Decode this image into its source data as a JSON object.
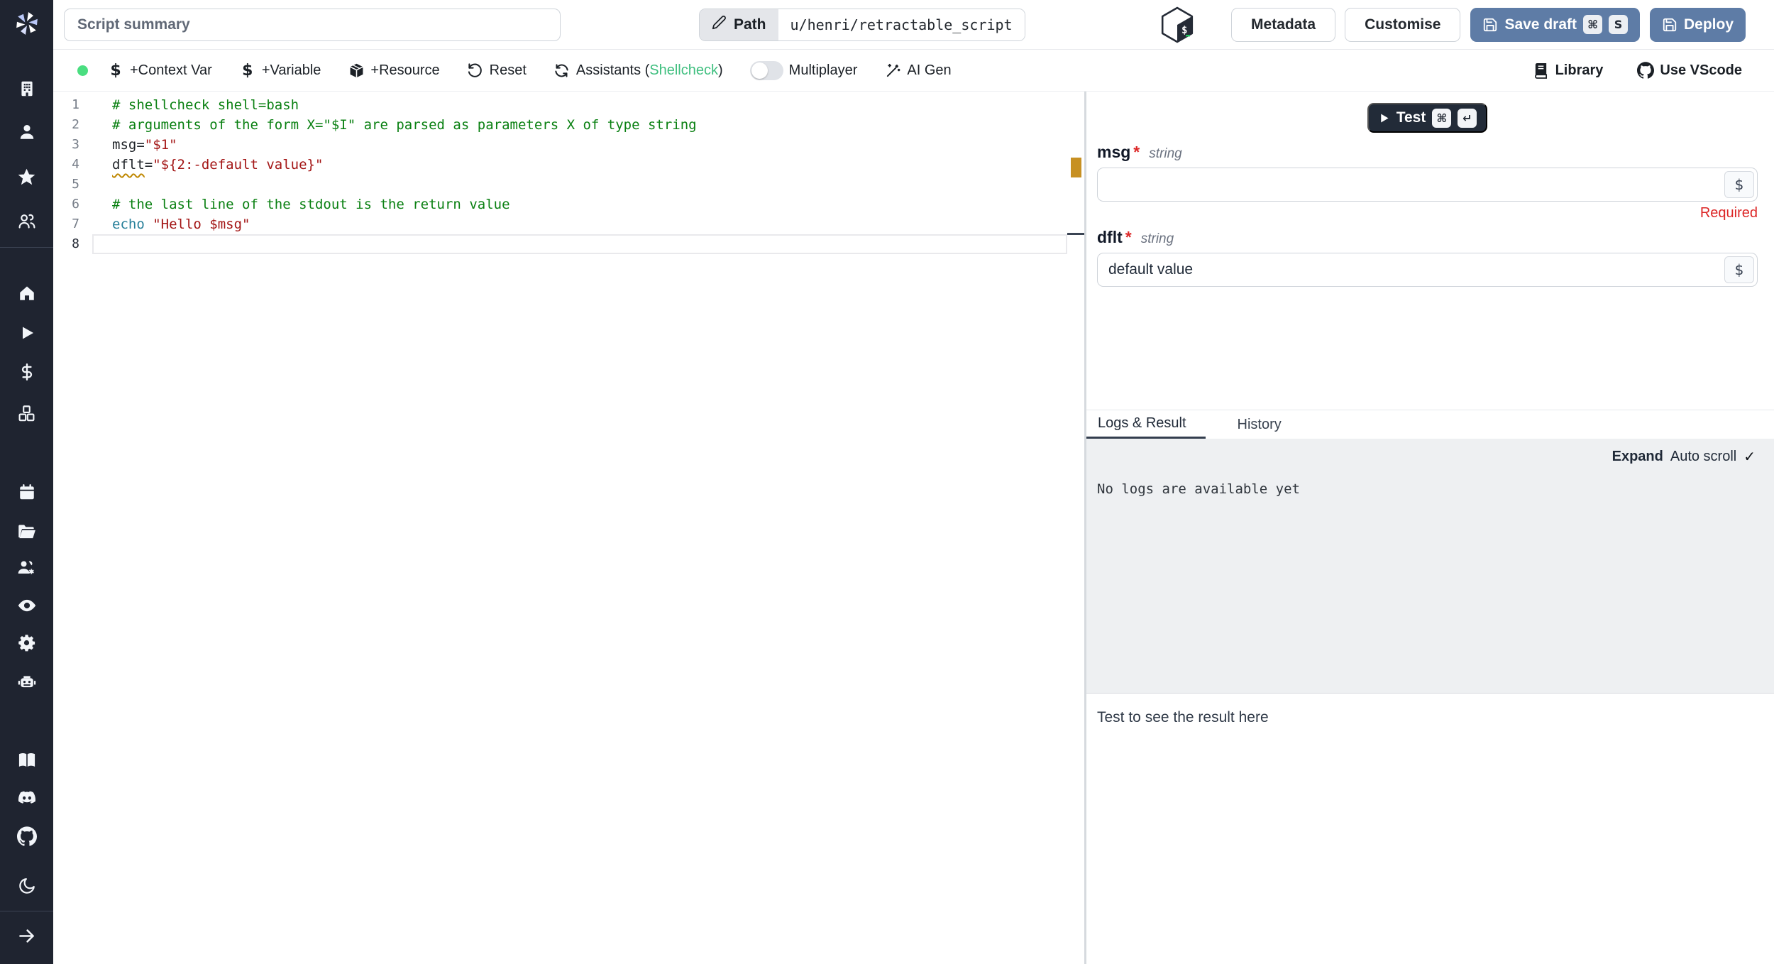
{
  "colors": {
    "accent_blue": "#5e7ca6",
    "sidebar_bg": "#1f2430",
    "status_green": "#4ade80",
    "lint_green": "#3fbf7f",
    "error_red": "#dc2626",
    "warning_amber": "#bf8803"
  },
  "topbar": {
    "summary_placeholder": "Script summary",
    "path_button": "Path",
    "path_value": "u/henri/retractable_script",
    "language_icon": "bash-icon",
    "metadata": "Metadata",
    "customise": "Customise",
    "save_draft": "Save draft",
    "save_draft_kbd": {
      "mod": "⌘",
      "key": "S"
    },
    "deploy": "Deploy"
  },
  "toolbar": {
    "items": [
      {
        "icon": "dollar-icon",
        "label": "+Context Var"
      },
      {
        "icon": "dollar-icon",
        "label": "+Variable"
      },
      {
        "icon": "package-icon",
        "label": "+Resource"
      },
      {
        "icon": "reset-icon",
        "label": "Reset"
      },
      {
        "icon": "refresh-icon",
        "label": "Assistants (",
        "highlight": "Shellcheck",
        "suffix": ")"
      },
      {
        "icon": "toggle",
        "label": "Multiplayer"
      },
      {
        "icon": "wand-icon",
        "label": "AI Gen"
      }
    ],
    "right_items": [
      {
        "icon": "book-icon",
        "label": "Library"
      },
      {
        "icon": "github-icon",
        "label": "Use VScode"
      }
    ]
  },
  "editor": {
    "lines": [
      {
        "n": "1",
        "segments": [
          {
            "cls": "comment",
            "text": "# shellcheck shell=bash"
          }
        ]
      },
      {
        "n": "2",
        "segments": [
          {
            "cls": "comment",
            "text": "# arguments of the form X=\"$I\" are parsed as parameters X of type string"
          }
        ]
      },
      {
        "n": "3",
        "segments": [
          {
            "cls": "plain",
            "text": "msg="
          },
          {
            "cls": "string",
            "text": "\"$1\""
          }
        ]
      },
      {
        "n": "4",
        "segments": [
          {
            "cls": "plain",
            "text": "dflt",
            "squiggle": true
          },
          {
            "cls": "plain",
            "text": "="
          },
          {
            "cls": "string",
            "text": "\"${2:-default value}\""
          }
        ]
      },
      {
        "n": "5",
        "segments": []
      },
      {
        "n": "6",
        "segments": [
          {
            "cls": "comment",
            "text": "# the last line of the stdout is the return value"
          }
        ]
      },
      {
        "n": "7",
        "segments": [
          {
            "cls": "keyword",
            "text": "echo"
          },
          {
            "cls": "plain",
            "text": " "
          },
          {
            "cls": "string",
            "text": "\"Hello $msg\""
          }
        ]
      },
      {
        "n": "8",
        "segments": [],
        "active": true
      }
    ]
  },
  "run_panel": {
    "test": "Test",
    "test_kbd": {
      "mod": "⌘",
      "key": "↵"
    },
    "fields": [
      {
        "name": "msg",
        "star": "*",
        "type": "string",
        "value": "",
        "error": "Required",
        "dollar": "$"
      },
      {
        "name": "dflt",
        "star": "*",
        "type": "string",
        "value": "default value",
        "dollar": "$"
      }
    ],
    "tabs": [
      {
        "label": "Logs & Result",
        "active": true
      },
      {
        "label": "History",
        "active": false
      }
    ],
    "logs": {
      "expand": "Expand",
      "autoscroll": "Auto scroll",
      "check": "✓",
      "empty": "No logs are available yet"
    },
    "result_placeholder": "Test to see the result here"
  },
  "sidebar": {
    "icons": [
      "building",
      "user",
      "star",
      "users",
      "home",
      "play",
      "dollar",
      "cubes",
      "calendar",
      "folder-open",
      "users-gear",
      "eye",
      "gear",
      "robot",
      "book-open",
      "discord",
      "github",
      "moon",
      "arrow-right"
    ]
  }
}
